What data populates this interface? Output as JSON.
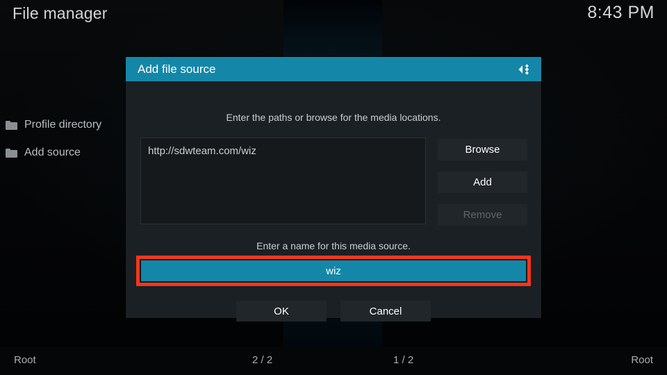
{
  "topbar": {
    "app_title": "File manager",
    "clock": "8:43 PM"
  },
  "sidebar": {
    "items": [
      {
        "label": "Profile directory",
        "icon": "folder-icon"
      },
      {
        "label": "Add source",
        "icon": "folder-icon"
      }
    ]
  },
  "dialog": {
    "title": "Add file source",
    "logo_icon": "kodi-logo-icon",
    "hint_paths": "Enter the paths or browse for the media locations.",
    "paths": [
      "http://sdwteam.com/wiz"
    ],
    "buttons": {
      "browse": "Browse",
      "add": "Add",
      "remove": "Remove"
    },
    "hint_name": "Enter a name for this media source.",
    "name_value": "wiz",
    "ok": "OK",
    "cancel": "Cancel"
  },
  "statusbar": {
    "left": "Root",
    "count_left": "2 / 2",
    "count_right": "1 / 2",
    "right": "Root"
  },
  "colors": {
    "accent_teal": "#1487a8",
    "highlight_red": "#f5361d",
    "dialog_bg": "#1b2024",
    "button_bg": "#20262a",
    "disabled_text": "#5e6568"
  }
}
